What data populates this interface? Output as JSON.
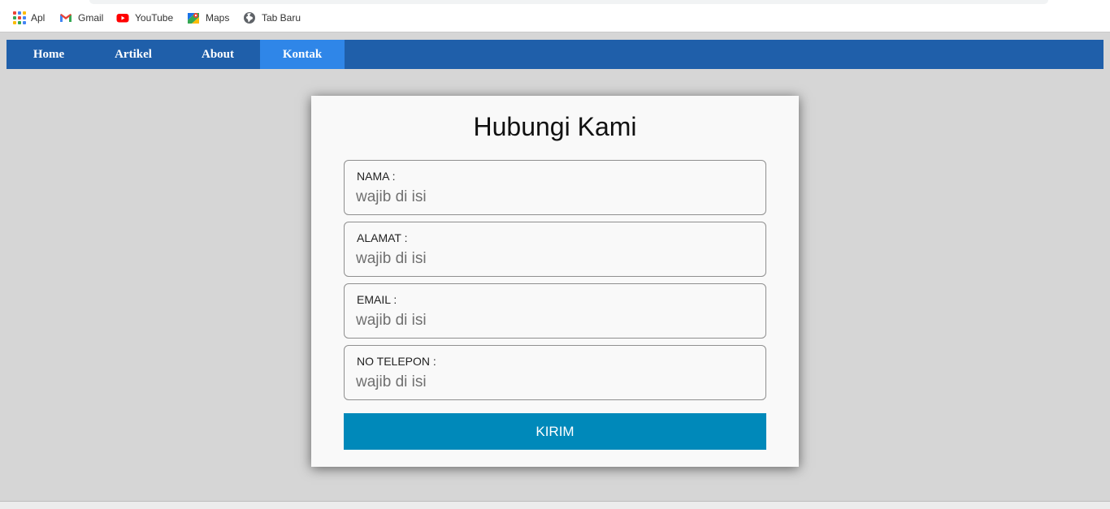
{
  "bookmarks": [
    {
      "label": "Apl",
      "icon": "apps-icon"
    },
    {
      "label": "Gmail",
      "icon": "gmail-icon"
    },
    {
      "label": "YouTube",
      "icon": "youtube-icon"
    },
    {
      "label": "Maps",
      "icon": "maps-icon"
    },
    {
      "label": "Tab Baru",
      "icon": "globe-icon"
    }
  ],
  "nav": {
    "items": [
      {
        "label": "Home"
      },
      {
        "label": "Artikel"
      },
      {
        "label": "About"
      },
      {
        "label": "Kontak"
      }
    ],
    "active": "Kontak"
  },
  "form": {
    "title": "Hubungi Kami",
    "fields": [
      {
        "label": "NAMA :",
        "placeholder": "wajib di isi",
        "value": ""
      },
      {
        "label": "ALAMAT :",
        "placeholder": "wajib di isi",
        "value": ""
      },
      {
        "label": "EMAIL :",
        "placeholder": "wajib di isi",
        "value": ""
      },
      {
        "label": "NO TELEPON :",
        "placeholder": "wajib di isi",
        "value": ""
      }
    ],
    "submit_label": "KIRIM"
  },
  "colors": {
    "nav_bg": "#1f5faa",
    "nav_active": "#2f86e8",
    "submit_bg": "#0089ba",
    "page_bg": "#d6d6d6"
  }
}
